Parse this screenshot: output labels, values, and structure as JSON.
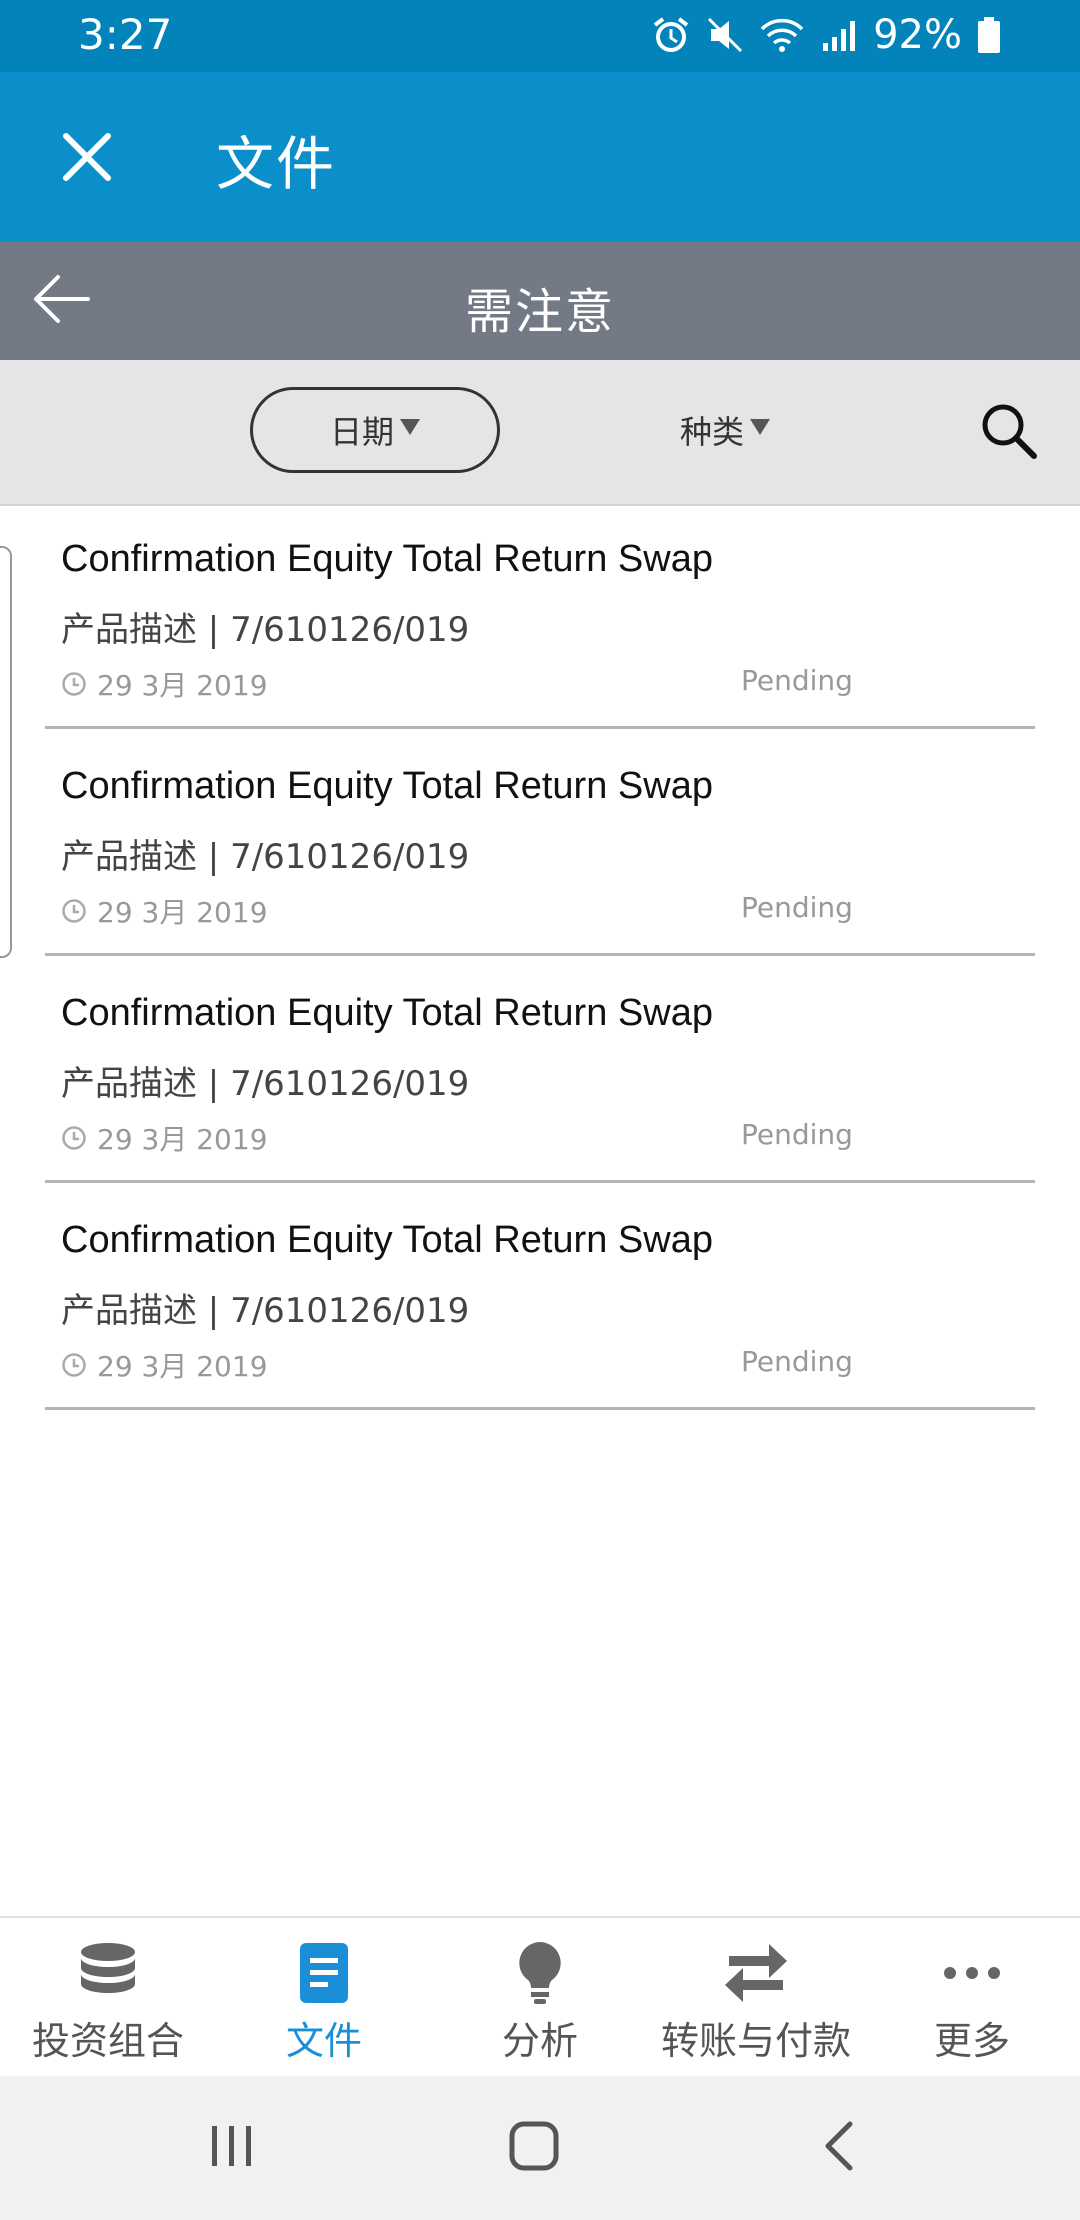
{
  "status_bar": {
    "time": "3:27",
    "battery": "92%"
  },
  "app_bar": {
    "title": "文件",
    "close_icon": "close-icon"
  },
  "sub_header": {
    "title": "需注意",
    "back_icon": "back-arrow-icon"
  },
  "filters": {
    "date_label": "日期",
    "kind_label": "种类",
    "search_icon": "search-icon"
  },
  "documents": [
    {
      "title": "Confirmation Equity Total Return Swap",
      "description": "产品描述 | 7/610126/019",
      "date": "29 3月 2019",
      "status": "Pending"
    },
    {
      "title": "Confirmation Equity Total Return Swap",
      "description": "产品描述 | 7/610126/019",
      "date": "29 3月 2019",
      "status": "Pending"
    },
    {
      "title": "Confirmation Equity Total Return Swap",
      "description": "产品描述 | 7/610126/019",
      "date": "29 3月 2019",
      "status": "Pending"
    },
    {
      "title": "Confirmation Equity Total Return Swap",
      "description": "产品描述 | 7/610126/019",
      "date": "29 3月 2019",
      "status": "Pending"
    }
  ],
  "bottom_nav": {
    "items": [
      {
        "label": "投资组合",
        "icon": "database-icon",
        "active": false
      },
      {
        "label": "文件",
        "icon": "document-icon",
        "active": true
      },
      {
        "label": "分析",
        "icon": "lightbulb-icon",
        "active": false
      },
      {
        "label": "转账与付款",
        "icon": "transfer-arrows-icon",
        "active": false
      },
      {
        "label": "更多",
        "icon": "more-dots-icon",
        "active": false
      }
    ]
  },
  "colors": {
    "status_bar": "#0284ba",
    "app_bar": "#0b8fcb",
    "sub_header": "#737a86",
    "accent": "#1a8fd8"
  }
}
